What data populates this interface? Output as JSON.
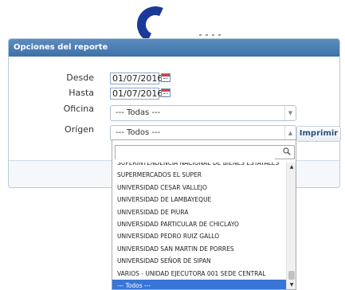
{
  "logo": {
    "name": "logo-arc"
  },
  "panel": {
    "title": "Opciones del reporte",
    "print_label": "Imprimir"
  },
  "form": {
    "desde_label": "Desde",
    "desde_value": "01/07/2016",
    "hasta_label": "Hasta",
    "hasta_value": "01/07/2016",
    "oficina_label": "Oficina",
    "oficina_value": "--- Todas ---",
    "origen_label": "Orígen",
    "origen_value": "--- Todos ---"
  },
  "dropdown": {
    "search_value": "",
    "items": [
      "SUPERINTENDENCIA NACIONAL DE BIENES ESTATALES",
      "SUPERMERCADOS EL SUPER",
      "UNIVERSIDAD CESAR VALLEJO",
      "UNIVERSIDAD DE LAMBAYEQUE",
      "UNIVERSIDAD DE PIURA",
      "UNIVERSIDAD PARTICULAR DE CHICLAYO",
      "UNIVERSIDAD PEDRO RUIZ GALLO",
      "UNIVERSIDAD SAN MARTIN DE PORRES",
      "UNIVERSIDAD SEÑOR DE SIPAN",
      "VARIOS - UNIDAD EJECUTORA 001 SEDE CENTRAL",
      "--- Todos ---"
    ],
    "selected": "--- Todos ---"
  },
  "colors": {
    "header_bg": "#4a7db5",
    "selected_bg": "#3875d7",
    "logo": "#1b3a97"
  }
}
